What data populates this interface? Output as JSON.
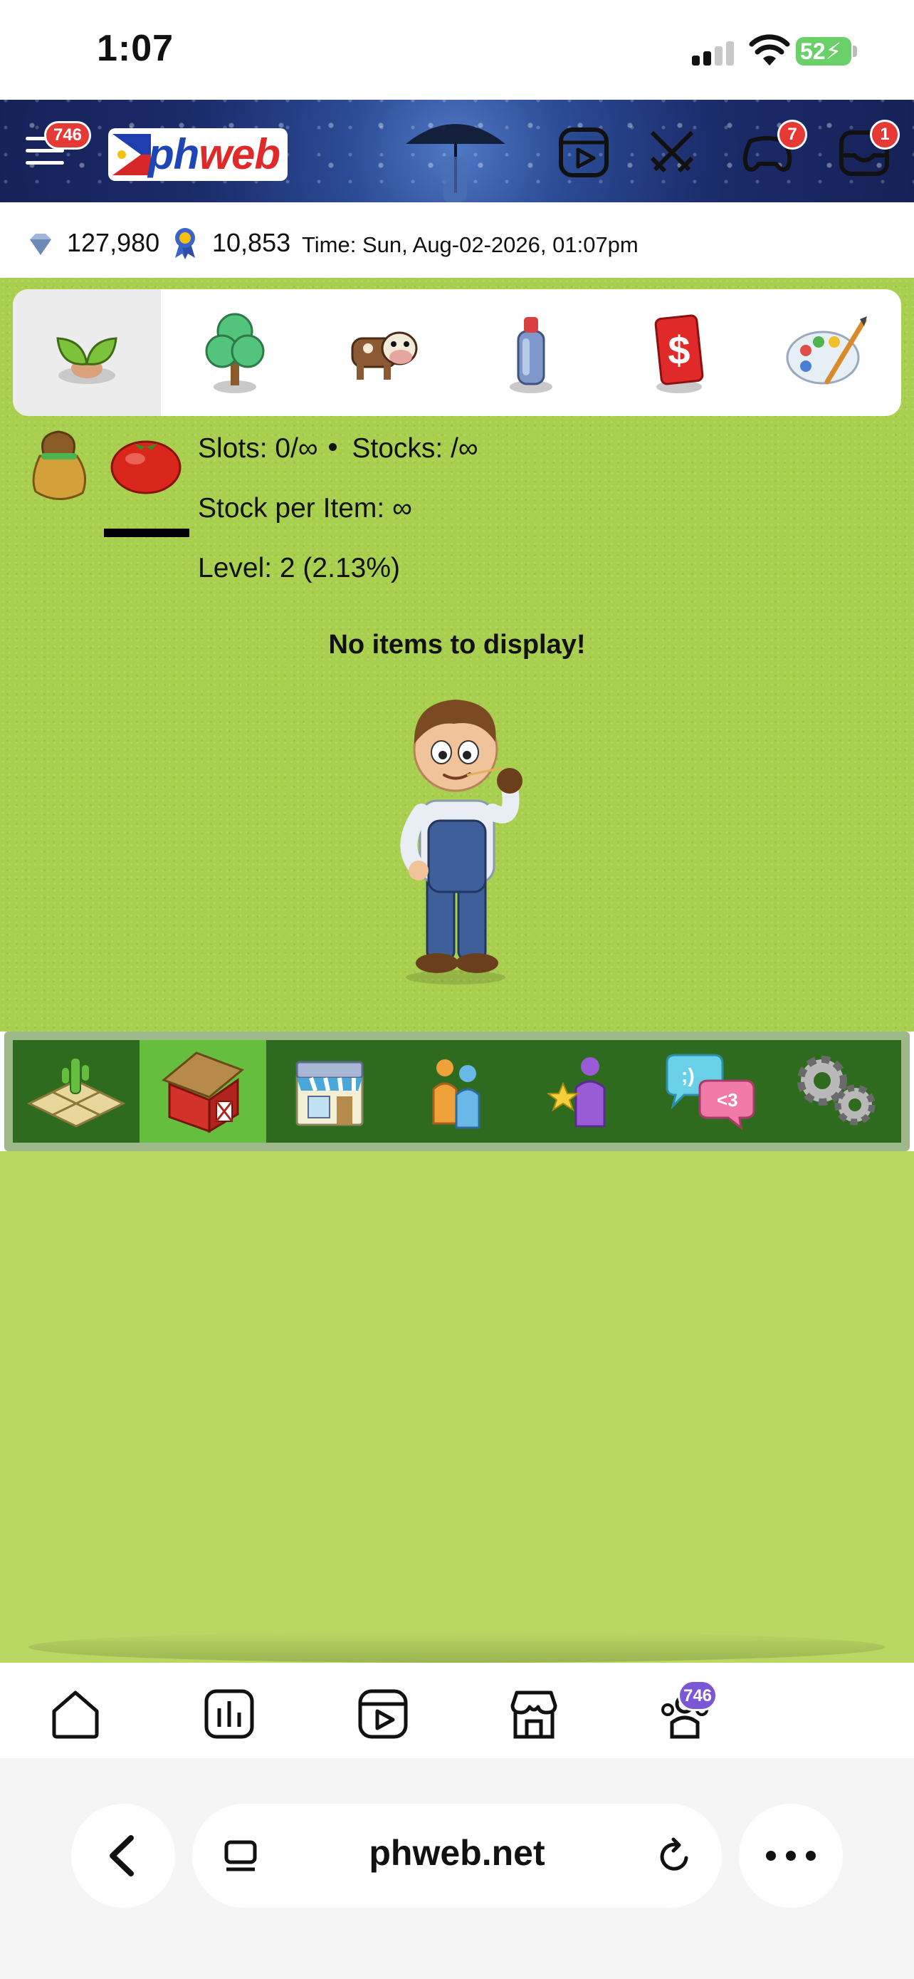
{
  "status_bar": {
    "time": "1:07",
    "battery": "52"
  },
  "header": {
    "menu_badge": "746",
    "logo_prefix": "ph",
    "logo_suffix": "web",
    "icons": [
      {
        "name": "reels-icon",
        "badge": ""
      },
      {
        "name": "swords-icon",
        "badge": ""
      },
      {
        "name": "gamepad-icon",
        "badge": "7"
      },
      {
        "name": "inbox-icon",
        "badge": "1"
      }
    ]
  },
  "info_bar": {
    "gems": "127,980",
    "points": "10,853",
    "time": "Time: Sun, Aug-02-2026, 01:07pm"
  },
  "category_tabs": [
    {
      "name": "sprout-icon",
      "active": true
    },
    {
      "name": "tree-icon",
      "active": false
    },
    {
      "name": "cow-icon",
      "active": false
    },
    {
      "name": "spray-can-icon",
      "active": false
    },
    {
      "name": "cash-icon",
      "active": false
    },
    {
      "name": "palette-icon",
      "active": false
    }
  ],
  "storage": {
    "slots": "Slots: 0/∞",
    "stocks": "Stocks: /∞",
    "stock_per_item": "Stock per Item: ∞",
    "level": "Level: 2 (2.13%)",
    "empty_message": "No items to display!"
  },
  "game_nav": [
    {
      "name": "farm-plot-icon",
      "active": false
    },
    {
      "name": "barn-icon",
      "active": true
    },
    {
      "name": "market-icon",
      "active": false
    },
    {
      "name": "neighbors-icon",
      "active": false
    },
    {
      "name": "favorite-person-icon",
      "active": false
    },
    {
      "name": "chat-icon",
      "active": false
    },
    {
      "name": "settings-gears-icon",
      "active": false
    }
  ],
  "browser_tabs": {
    "icons": [
      "home-icon",
      "stats-icon",
      "video-icon",
      "shop-icon",
      "community-icon"
    ],
    "community_badge": "746"
  },
  "browser_bar": {
    "url": "phweb.net"
  },
  "colors": {
    "grass": "#a9cf4f",
    "nav_dark": "#2e6b1f",
    "nav_active": "#66be3f",
    "badge_red": "#e53935",
    "badge_purple": "#7b57d6"
  }
}
